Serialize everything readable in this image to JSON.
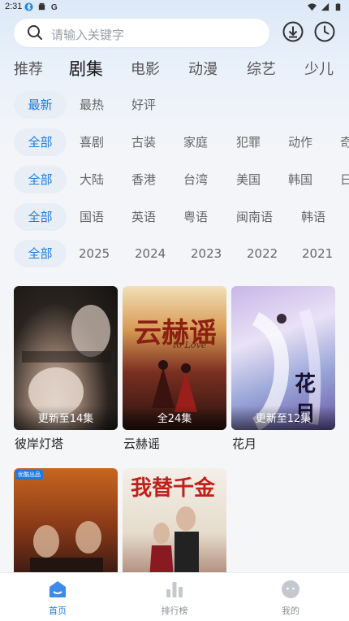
{
  "status_bar": {
    "time": "2:31",
    "left_icons": [
      "bluetooth-icon",
      "card-icon",
      "google-icon"
    ],
    "right_icons": [
      "wifi-icon",
      "signal-icon",
      "battery-icon"
    ]
  },
  "search": {
    "placeholder": "请输入关键字"
  },
  "toolbar": {
    "icons": [
      "download-icon",
      "history-clock-icon"
    ]
  },
  "tabs": [
    {
      "label": "推荐",
      "active": false
    },
    {
      "label": "剧集",
      "active": true
    },
    {
      "label": "电影",
      "active": false
    },
    {
      "label": "动漫",
      "active": false
    },
    {
      "label": "综艺",
      "active": false
    },
    {
      "label": "少儿",
      "active": false
    }
  ],
  "filters": {
    "sort": [
      "最新",
      "最热",
      "好评"
    ],
    "genre": [
      "全部",
      "喜剧",
      "古装",
      "家庭",
      "犯罪",
      "动作",
      "奇"
    ],
    "region": [
      "全部",
      "大陆",
      "香港",
      "台湾",
      "美国",
      "韩国",
      "日"
    ],
    "language": [
      "全部",
      "国语",
      "英语",
      "粤语",
      "闽南语",
      "韩语"
    ],
    "year": [
      "全部",
      "2025",
      "2024",
      "2023",
      "2022",
      "2021"
    ]
  },
  "cards": [
    {
      "title": "彼岸灯塔",
      "badge": "更新至14集",
      "poster_text": ""
    },
    {
      "title": "云赫谣",
      "badge": "全24集",
      "poster_text": "云赫谣",
      "poster_sub": "to Love"
    },
    {
      "title": "花月",
      "badge": "更新至12集",
      "poster_text": "花月"
    },
    {
      "title": "",
      "badge": "",
      "poster_text": "",
      "poster_tag": "优酷出品"
    },
    {
      "title": "",
      "badge": "",
      "poster_text": "我替千金"
    }
  ],
  "bottom_nav": [
    {
      "label": "首页",
      "active": true,
      "icon": "home-icon"
    },
    {
      "label": "排行榜",
      "active": false,
      "icon": "ranking-icon"
    },
    {
      "label": "我的",
      "active": false,
      "icon": "profile-icon"
    }
  ],
  "colors": {
    "accent": "#1e7ae0",
    "chip_bg": "#e8eef6",
    "text_secondary": "#666666"
  }
}
